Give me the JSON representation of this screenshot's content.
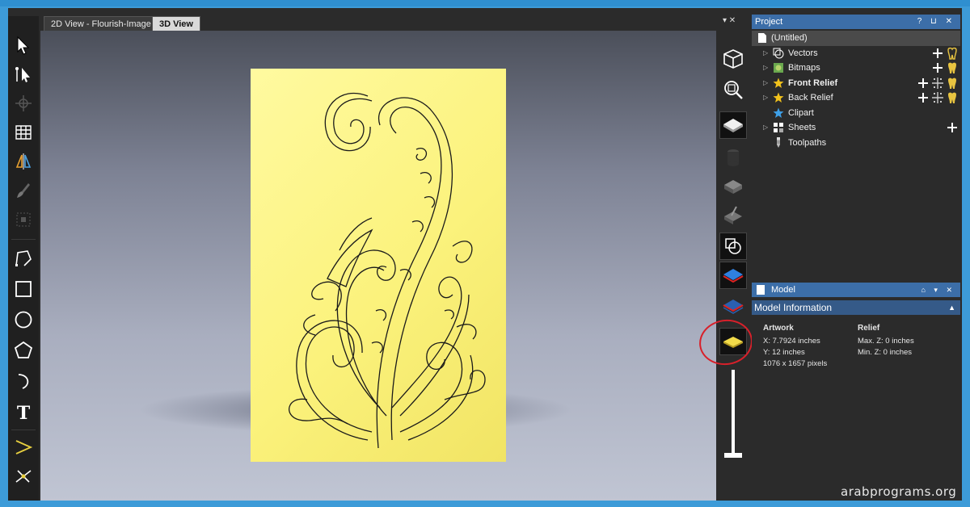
{
  "tabs": [
    {
      "label": "2D View - Flourish-Image",
      "active": false
    },
    {
      "label": "3D View",
      "active": true
    }
  ],
  "toolbar": {
    "tools": [
      "select-arrow-icon",
      "node-edit-icon",
      "transform-icon",
      "mesh-icon",
      "mirror-icon",
      "brush-icon",
      "grid-snap-icon",
      "polyline-icon",
      "rectangle-icon",
      "ellipse-icon",
      "polygon-icon",
      "arc-icon",
      "text-icon",
      "offset-icon",
      "trim-icon",
      "extend-icon"
    ]
  },
  "viewstrip": {
    "header_controls": "▾ ✕",
    "icons": [
      "iso-cube-icon",
      "zoom-fit-icon",
      "relief-layer-icon",
      "cylinder-icon",
      "solid-cube-icon",
      "brush-cube-icon",
      "vector-circle-icon",
      "blue-layer-icon",
      "red-blue-layer-icon",
      "yellow-layer-icon"
    ]
  },
  "project": {
    "title": "Project",
    "controls": "? ⊔ ✕",
    "root": "(Untitled)",
    "items": [
      {
        "label": "Vectors",
        "icon": "vectors-icon",
        "expandable": true,
        "bold": false,
        "add": true,
        "grid": false,
        "tooth": true
      },
      {
        "label": "Bitmaps",
        "icon": "bitmaps-icon",
        "expandable": true,
        "bold": false,
        "add": true,
        "grid": false,
        "tooth": true
      },
      {
        "label": "Front Relief",
        "icon": "star-icon",
        "expandable": true,
        "bold": true,
        "add": true,
        "grid": true,
        "tooth": true
      },
      {
        "label": "Back Relief",
        "icon": "star-icon",
        "expandable": true,
        "bold": false,
        "add": true,
        "grid": true,
        "tooth": true
      },
      {
        "label": "Clipart",
        "icon": "blue-star-icon",
        "expandable": false,
        "bold": false,
        "add": false,
        "grid": false,
        "tooth": false
      },
      {
        "label": "Sheets",
        "icon": "sheets-icon",
        "expandable": true,
        "bold": false,
        "add": true,
        "grid": false,
        "tooth": false
      },
      {
        "label": "Toolpaths",
        "icon": "toolpaths-icon",
        "expandable": false,
        "bold": false,
        "add": false,
        "grid": false,
        "tooth": false
      }
    ]
  },
  "model": {
    "title": "Model",
    "controls": "⌂ ▾ ✕"
  },
  "model_info": {
    "title": "Model Information",
    "artwork_heading": "Artwork",
    "artwork_x": "X: 7.7924 inches",
    "artwork_y": "Y: 12 inches",
    "artwork_pixels": "1076 x 1657 pixels",
    "relief_heading": "Relief",
    "relief_max": "Max. Z: 0 inches",
    "relief_min": "Min. Z: 0 inches"
  },
  "watermark": "arabprograms.org",
  "colors": {
    "panel_yellow": "#fbf27c",
    "header_blue": "#3c6ea8",
    "highlight_red": "#d8202a"
  }
}
